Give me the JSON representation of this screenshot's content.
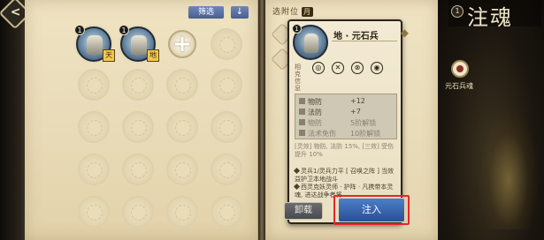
{
  "header": {
    "back_icon": "back-arrow-icon",
    "filter_label": "筛选",
    "sort_label": "↓"
  },
  "inventory": {
    "souls": [
      {
        "level": "1",
        "tag": "天"
      },
      {
        "level": "1",
        "tag": "地"
      }
    ],
    "add_label": "+"
  },
  "right_title": {
    "text": "选附位",
    "badge": "月"
  },
  "detail": {
    "level": "1",
    "name": "地 · 元石兵",
    "sub_label": "相克信息",
    "slots": [
      "◎",
      "✕",
      "⊗",
      "◉"
    ],
    "stats": [
      {
        "label": "物防",
        "value": "+12"
      },
      {
        "label": "法防",
        "value": "+7"
      },
      {
        "label": "物防",
        "value": "5阶解锁"
      },
      {
        "label": "法术免伤",
        "value": "10阶解锁"
      }
    ],
    "effect": "[灵效] 物防, 法防 15%, [三效] 受伤提升 10%",
    "skills": [
      "灵兵1/灵兵力平 [ 召唤之阵 ] 当效益护卫本地战斗",
      "西灵克妖灵师 · 护阵 · 凡携带本灵魂, 进达战争者将"
    ]
  },
  "buttons": {
    "unload_label": "卸载",
    "inject_label": "注入"
  },
  "side_panel": {
    "title": "注魂",
    "title_icon": "1",
    "tab_label": "元石兵魂"
  }
}
